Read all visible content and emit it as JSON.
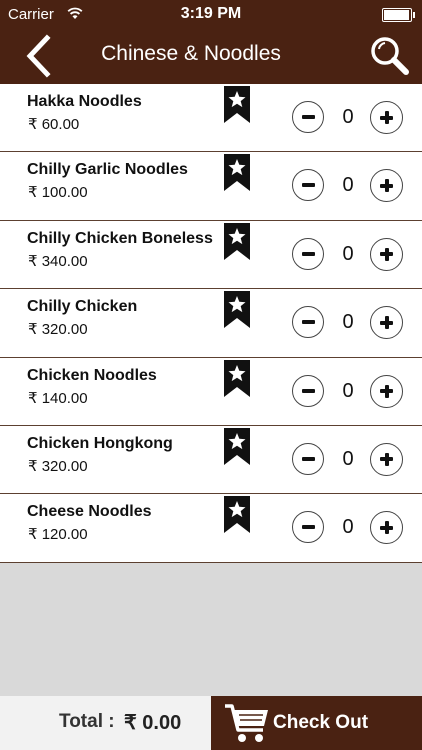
{
  "status_bar": {
    "carrier": "Carrier",
    "time": "3:19 PM",
    "battery_level": 0.95
  },
  "header": {
    "title": "Chinese & Noodles",
    "back_icon": "chevron-left-icon",
    "search_icon": "search-icon"
  },
  "items": [
    {
      "name": "Hakka Noodles",
      "price": "₹ 60.00",
      "qty": "0"
    },
    {
      "name": "Chilly Garlic Noodles",
      "price": "₹ 100.00",
      "qty": "0"
    },
    {
      "name": "Chilly Chicken Boneless",
      "price": "₹ 340.00",
      "qty": "0"
    },
    {
      "name": "Chilly Chicken",
      "price": "₹ 320.00",
      "qty": "0"
    },
    {
      "name": "Chicken Noodles",
      "price": "₹ 140.00",
      "qty": "0"
    },
    {
      "name": "Chicken Hongkong",
      "price": "₹ 320.00",
      "qty": "0"
    },
    {
      "name": "Cheese Noodles",
      "price": "₹ 120.00",
      "qty": "0"
    }
  ],
  "footer": {
    "total_label": "Total :",
    "total_amount": "₹ 0.00",
    "checkout_label": "Check Out"
  },
  "colors": {
    "brand": "#4a2212",
    "background": "#d9d9d9"
  }
}
